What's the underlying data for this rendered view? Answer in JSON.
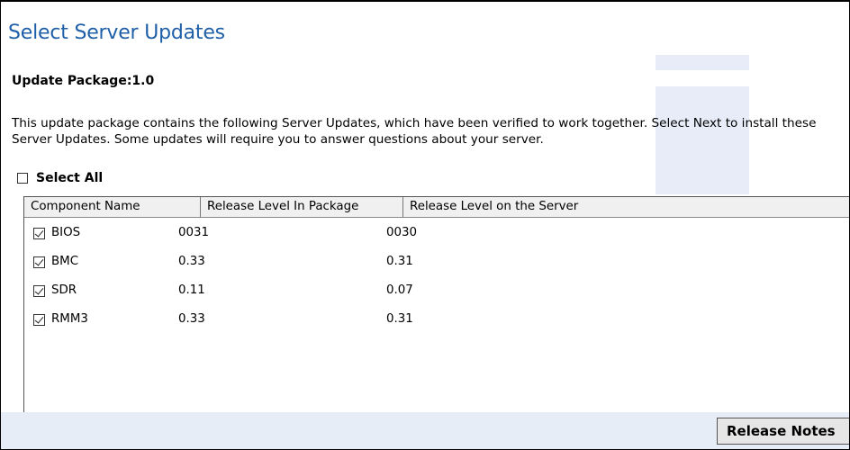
{
  "page": {
    "title": "Select Server Updates",
    "package_label": "Update Package:1.0",
    "description": "This update package contains the following Server Updates, which have been verified to work together. Select Next to install these Server Updates. Some updates will require you to answer questions about your server.",
    "select_all_label": "Select All",
    "select_all_checked": false
  },
  "table": {
    "columns": [
      "Component Name",
      "Release Level In Package",
      "Release Level on the Server"
    ],
    "rows": [
      {
        "checked": true,
        "component": "BIOS",
        "package_level": "0031",
        "server_level": "0030"
      },
      {
        "checked": true,
        "component": "BMC",
        "package_level": "0.33",
        "server_level": "0.31"
      },
      {
        "checked": true,
        "component": "SDR",
        "package_level": "0.11",
        "server_level": "0.07"
      },
      {
        "checked": true,
        "component": "RMM3",
        "package_level": "0.33",
        "server_level": "0.31"
      }
    ]
  },
  "footer": {
    "release_notes_label": "Release Notes"
  },
  "colors": {
    "title": "#1f5fa8",
    "footer_bg": "#e6edf7",
    "decoration": "#e7ecf8"
  }
}
